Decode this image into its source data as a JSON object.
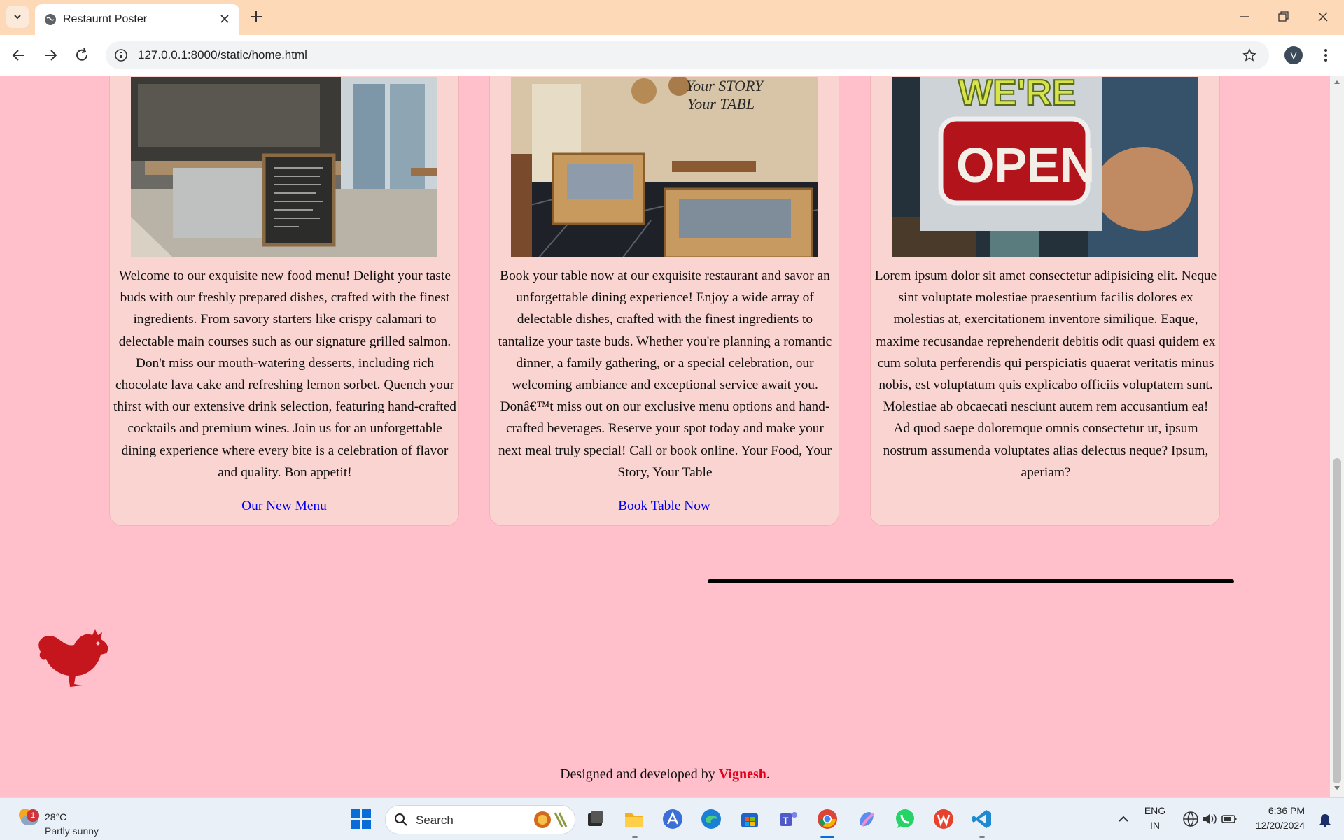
{
  "browser": {
    "tab_title": "Restaurnt Poster",
    "url": "127.0.0.1:8000/static/home.html",
    "profile_initial": "V"
  },
  "cards": [
    {
      "description": "Welcome to our exquisite new food menu! Delight your taste buds with our freshly prepared dishes, crafted with the finest ingredients. From savory starters like crispy calamari to delectable main courses such as our signature grilled salmon. Don't miss our mouth-watering desserts, including rich chocolate lava cake and refreshing lemon sorbet. Quench your thirst with our extensive drink selection, featuring hand-crafted cocktails and premium wines. Join us for an unforgettable dining experience where every bite is a celebration of flavor and quality. Bon appetit!",
      "link": "Our New Menu"
    },
    {
      "description": "Book your table now at our exquisite restaurant and savor an unforgettable dining experience! Enjoy a wide array of delectable dishes, crafted with the finest ingredients to tantalize your taste buds. Whether you're planning a romantic dinner, a family gathering, or a special celebration, our welcoming ambiance and exceptional service await you. Donâ€™t miss out on our exclusive menu options and hand-crafted beverages. Reserve your spot today and make your next meal truly special! Call or book online. Your Food, Your Story, Your Table",
      "link": "Book Table Now",
      "photo_sign": [
        "Your STORY",
        "Your TABL"
      ]
    },
    {
      "description": "Lorem ipsum dolor sit amet consectetur adipisicing elit. Neque sint voluptate molestiae praesentium facilis dolores ex molestias at, exercitationem inventore similique. Eaque, maxime recusandae reprehenderit debitis odit quasi quidem ex cum soluta perferendis qui perspiciatis quaerat veritatis minus nobis, est voluptatum quis explicabo officiis voluptatem sunt. Molestiae ab obcaecati nesciunt autem rem accusantium ea! Ad quod saepe doloremque omnis consectetur ut, ipsum nostrum assumenda voluptates alias delectus neque? Ipsum, aperiam?",
      "photo_sign": [
        "WE'RE",
        "OPEN"
      ]
    }
  ],
  "footer": {
    "prefix": "Designed and developed by ",
    "author": "Vignesh",
    "suffix": "."
  },
  "taskbar": {
    "weather_temp": "28°C",
    "weather_condition": "Partly sunny",
    "weather_badge": "1",
    "search_label": "Search",
    "language": "ENG",
    "region": "IN",
    "time": "6:36 PM",
    "date": "12/20/2024"
  },
  "colors": {
    "page_background": "#ffc0cb",
    "card_background": "#fad4d1",
    "link": "#0000ee",
    "author": "#e0001b",
    "titlebar": "#fdd9b8"
  }
}
